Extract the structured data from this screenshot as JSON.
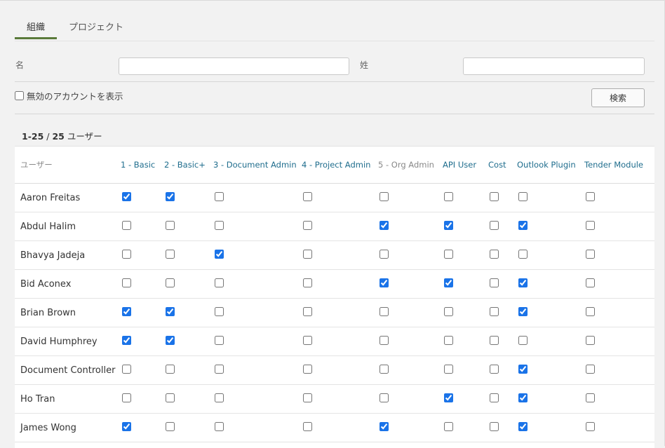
{
  "tabs": [
    {
      "label": "組織",
      "active": true
    },
    {
      "label": "プロジェクト",
      "active": false
    }
  ],
  "search": {
    "first_name_label": "名",
    "first_name_value": "",
    "last_name_label": "姓",
    "last_name_value": "",
    "show_disabled_label": "無効のアカウントを表示",
    "show_disabled_checked": false,
    "search_button": "検索"
  },
  "results": {
    "range": "1-25",
    "separator": " / ",
    "total": "25",
    "suffix": " ユーザー"
  },
  "table": {
    "user_header": "ユーザー",
    "columns": [
      "1 - Basic",
      "2 - Basic+",
      "3 - Document Admin",
      "4 - Project Admin",
      "5 - Org Admin",
      "API User",
      "Cost",
      "Outlook Plugin",
      "Tender Module"
    ],
    "rows": [
      {
        "name": "Aaron Freitas",
        "checks": [
          true,
          true,
          false,
          false,
          false,
          false,
          false,
          false,
          false
        ]
      },
      {
        "name": "Abdul Halim",
        "checks": [
          false,
          false,
          false,
          false,
          true,
          true,
          false,
          true,
          false
        ]
      },
      {
        "name": "Bhavya Jadeja",
        "checks": [
          false,
          false,
          true,
          false,
          false,
          false,
          false,
          false,
          false
        ]
      },
      {
        "name": "Bid Aconex",
        "checks": [
          false,
          false,
          false,
          false,
          true,
          true,
          false,
          true,
          false
        ]
      },
      {
        "name": "Brian Brown",
        "checks": [
          true,
          true,
          false,
          false,
          false,
          false,
          false,
          true,
          false
        ]
      },
      {
        "name": "David Humphrey",
        "checks": [
          true,
          true,
          false,
          false,
          false,
          false,
          false,
          false,
          false
        ]
      },
      {
        "name": "Document Controller",
        "checks": [
          false,
          false,
          false,
          false,
          false,
          false,
          false,
          true,
          false
        ]
      },
      {
        "name": "Ho Tran",
        "checks": [
          false,
          false,
          false,
          false,
          false,
          true,
          false,
          true,
          false
        ]
      },
      {
        "name": "James Wong",
        "checks": [
          true,
          false,
          false,
          false,
          true,
          false,
          false,
          true,
          false
        ]
      }
    ]
  },
  "colors": {
    "accent": "#5a7a3a",
    "link": "#1f6d8d",
    "checkbox": "#1a73e8"
  }
}
